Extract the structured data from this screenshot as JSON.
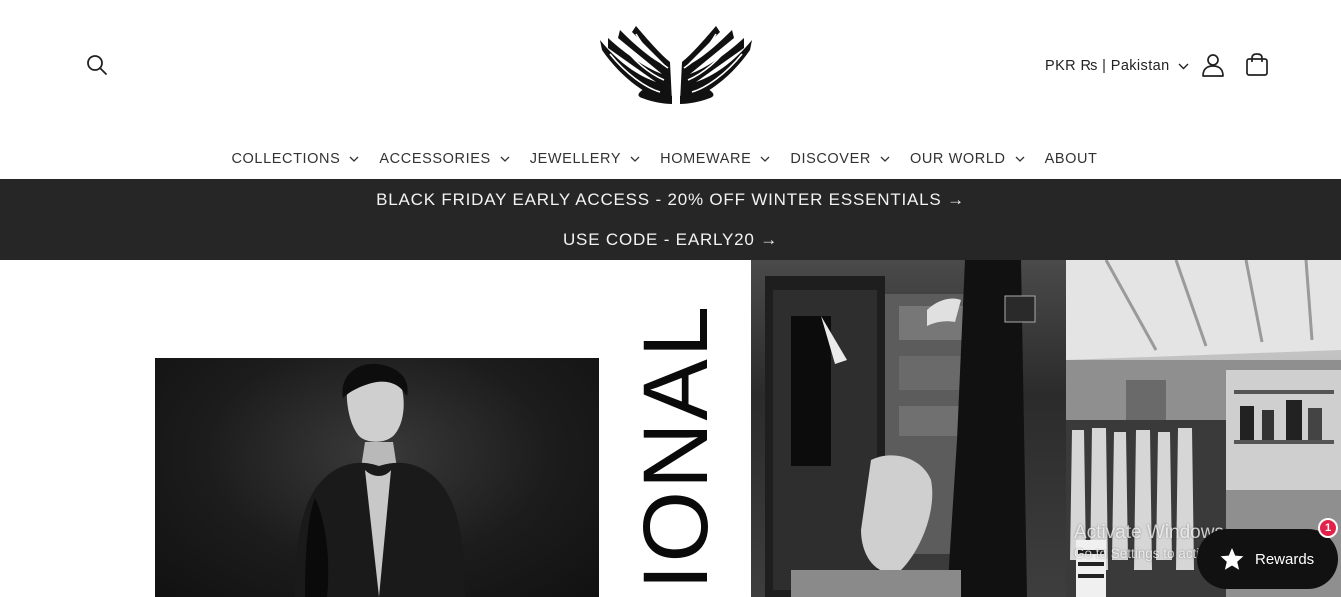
{
  "header": {
    "search_icon": "search-icon",
    "logo_icon": "wings-logo-icon",
    "currency_label": "PKR ₨ | Pakistan",
    "account_icon": "user-icon",
    "cart_icon": "cart-icon"
  },
  "nav": {
    "items": [
      {
        "label": "COLLECTIONS",
        "has_dropdown": true
      },
      {
        "label": "ACCESSORIES",
        "has_dropdown": true
      },
      {
        "label": "JEWELLERY",
        "has_dropdown": true
      },
      {
        "label": "HOMEWARE",
        "has_dropdown": true
      },
      {
        "label": "DISCOVER",
        "has_dropdown": true
      },
      {
        "label": "OUR WORLD",
        "has_dropdown": true
      },
      {
        "label": "ABOUT",
        "has_dropdown": false
      }
    ]
  },
  "announcement": {
    "line1": "BLACK FRIDAY EARLY ACCESS - 20% OFF WINTER ESSENTIALS →",
    "line2": "USE CODE - EARLY20 →",
    "background": "#262626"
  },
  "hero": {
    "vertical_text": "IONAL"
  },
  "os_watermark": {
    "line1": "Activate Windows",
    "line2": "Go to Settings to activate Windows."
  },
  "rewards": {
    "label": "Rewards",
    "badge_count": "1",
    "icon": "star-icon",
    "badge_color": "#e3224c"
  }
}
